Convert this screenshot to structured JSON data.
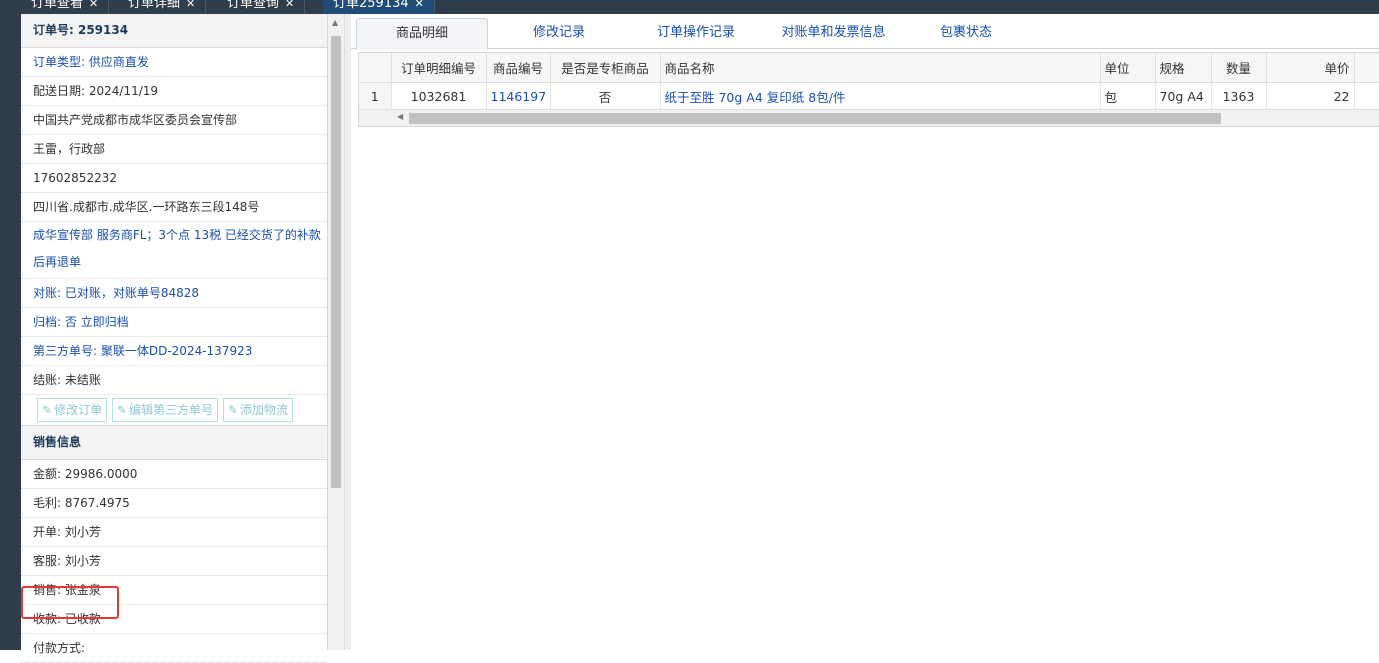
{
  "top_tabs": [
    {
      "label": "订单查看",
      "close": "✕"
    },
    {
      "label": "订单详细",
      "close": "✕"
    },
    {
      "label": "订单查询",
      "close": "✕"
    },
    {
      "label": "订单259134",
      "close": "✕"
    }
  ],
  "order": {
    "header": "订单号: 259134",
    "type": "订单类型: 供应商直发",
    "delivery_date": "配送日期: 2024/11/19",
    "customer": "中国共产党成都市成华区委员会宣传部",
    "contact": "王雷，行政部",
    "phone": "17602852232",
    "address": "四川省.成都市.成华区.一环路东三段148号",
    "remark": "成华宣传部 服务商FL；3个点 13税 已经交货了的补款后再退单",
    "reconcile": "对账: 已对账，对账单号84828",
    "archive": "归档:  否 立即归档",
    "third_party": "第三方单号: 聚联一体DD-2024-137923",
    "settle": "结账: 未结账",
    "buttons": {
      "edit_order": "修改订单",
      "edit_third": "编辑第三方单号",
      "add_logistics": "添加物流"
    }
  },
  "sales": {
    "header": "销售信息",
    "amount": "金额: 29986.0000",
    "profit": "毛利: 8767.4975",
    "issuer": "开单: 刘小芳",
    "service": "客服: 刘小芳",
    "salesperson": "销售: 张金泉",
    "payment_status": "收款: 已收款",
    "payment_method": "付款方式:"
  },
  "detail_tabs": [
    "商品明细",
    "修改记录",
    "订单操作记录",
    "对账单和发票信息",
    "包裹状态"
  ],
  "grid": {
    "columns": [
      "订单明细编号",
      "商品编号",
      "是否是专柜商品",
      "商品名称",
      "单位",
      "规格",
      "数量",
      "单价"
    ],
    "rows": [
      {
        "rn": "1",
        "detail_id": "1032681",
        "product_id": "1146197",
        "is_counter": "否",
        "name": "纸于至胜 70g A4 复印纸 8包/件",
        "unit": "包",
        "spec": "70g A4",
        "qty": "1363",
        "price": "22"
      }
    ]
  },
  "icons": {
    "edit": "edit-icon",
    "close": "close-icon"
  }
}
